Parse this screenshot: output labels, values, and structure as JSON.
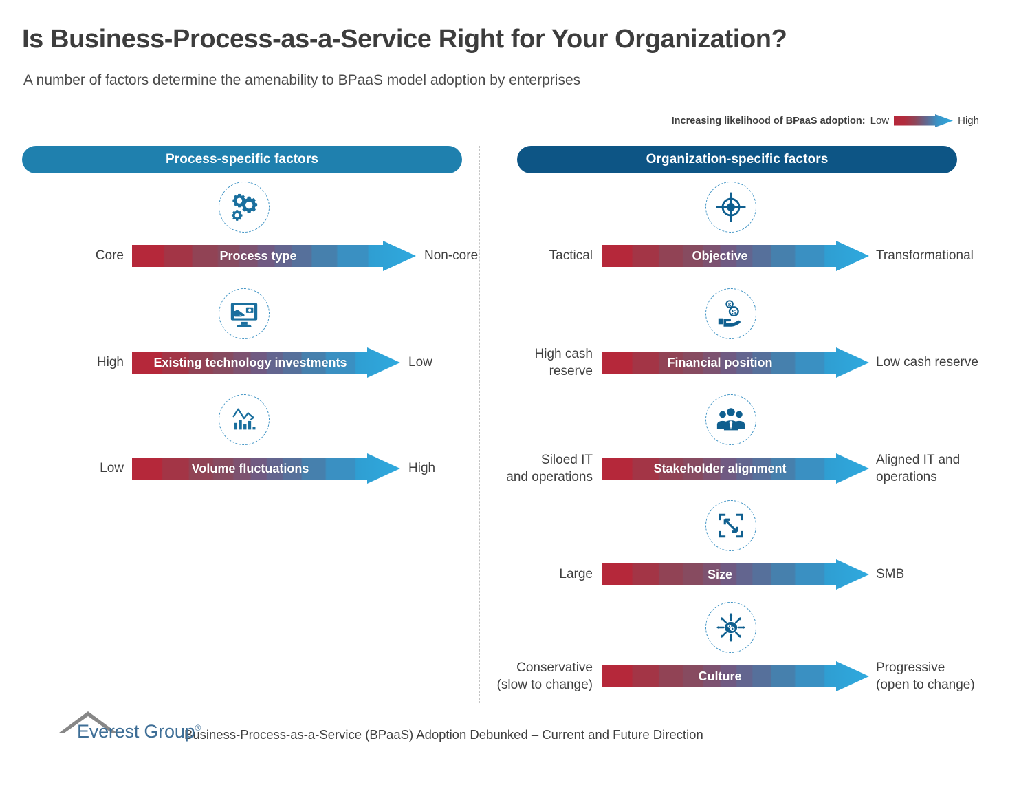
{
  "header": {
    "title": "Is Business-Process-as-a-Service Right for Your Organization?",
    "subtitle": "A number of factors determine the amenability to BPaaS model adoption by enterprises"
  },
  "legend": {
    "label": "Increasing likelihood of BPaaS adoption:",
    "low": "Low",
    "high": "High"
  },
  "colors": {
    "header_light_blue": "#1f80ae",
    "header_dark_blue": "#0d5585",
    "icon_blue": "#1a6f9e",
    "icon_blue_dark": "#0f5f8f",
    "gradient_red": "#b5283a",
    "gradient_mid": "#8c4a60",
    "gradient_blue": "#2fa3dd",
    "divider_gray": "#c4c4c4",
    "logo_blue": "#3e6e96",
    "logo_gray": "#7d7d7d"
  },
  "columns": [
    {
      "id": "process",
      "heading": "Process-specific factors",
      "style": "light",
      "rows": [
        {
          "icon": "gears-icon",
          "left_label": [
            "Core"
          ],
          "bar_label": "Process type",
          "right_label": [
            "Non-core"
          ]
        },
        {
          "icon": "monitor-investment-icon",
          "left_label": [
            "High"
          ],
          "bar_label": "Existing technology investments",
          "right_label": [
            "Low"
          ]
        },
        {
          "icon": "volume-chart-icon",
          "left_label": [
            "Low"
          ],
          "bar_label": "Volume fluctuations",
          "right_label": [
            "High"
          ]
        }
      ]
    },
    {
      "id": "organization",
      "heading": "Organization-specific factors",
      "style": "dark",
      "rows": [
        {
          "icon": "target-icon",
          "left_label": [
            "Tactical"
          ],
          "bar_label": "Objective",
          "right_label": [
            "Transformational"
          ]
        },
        {
          "icon": "hand-money-icon",
          "left_label": [
            "High cash",
            "reserve"
          ],
          "bar_label": "Financial position",
          "right_label": [
            "Low cash reserve"
          ]
        },
        {
          "icon": "stakeholders-icon",
          "left_label": [
            "Siloed IT",
            "and operations"
          ],
          "bar_label": "Stakeholder alignment",
          "right_label": [
            "Aligned IT and",
            "operations"
          ]
        },
        {
          "icon": "resize-icon",
          "left_label": [
            "Large"
          ],
          "bar_label": "Size",
          "right_label": [
            "SMB"
          ]
        },
        {
          "icon": "culture-gear-icon",
          "left_label": [
            "Conservative",
            "(slow to change)"
          ],
          "bar_label": "Culture",
          "right_label": [
            "Progressive",
            "(open to change)"
          ]
        }
      ]
    }
  ],
  "footer": {
    "logo_text": "Everest Group",
    "logo_reg": "®",
    "caption": "Business-Process-as-a-Service (BPaaS) Adoption Debunked – Current and Future Direction"
  }
}
